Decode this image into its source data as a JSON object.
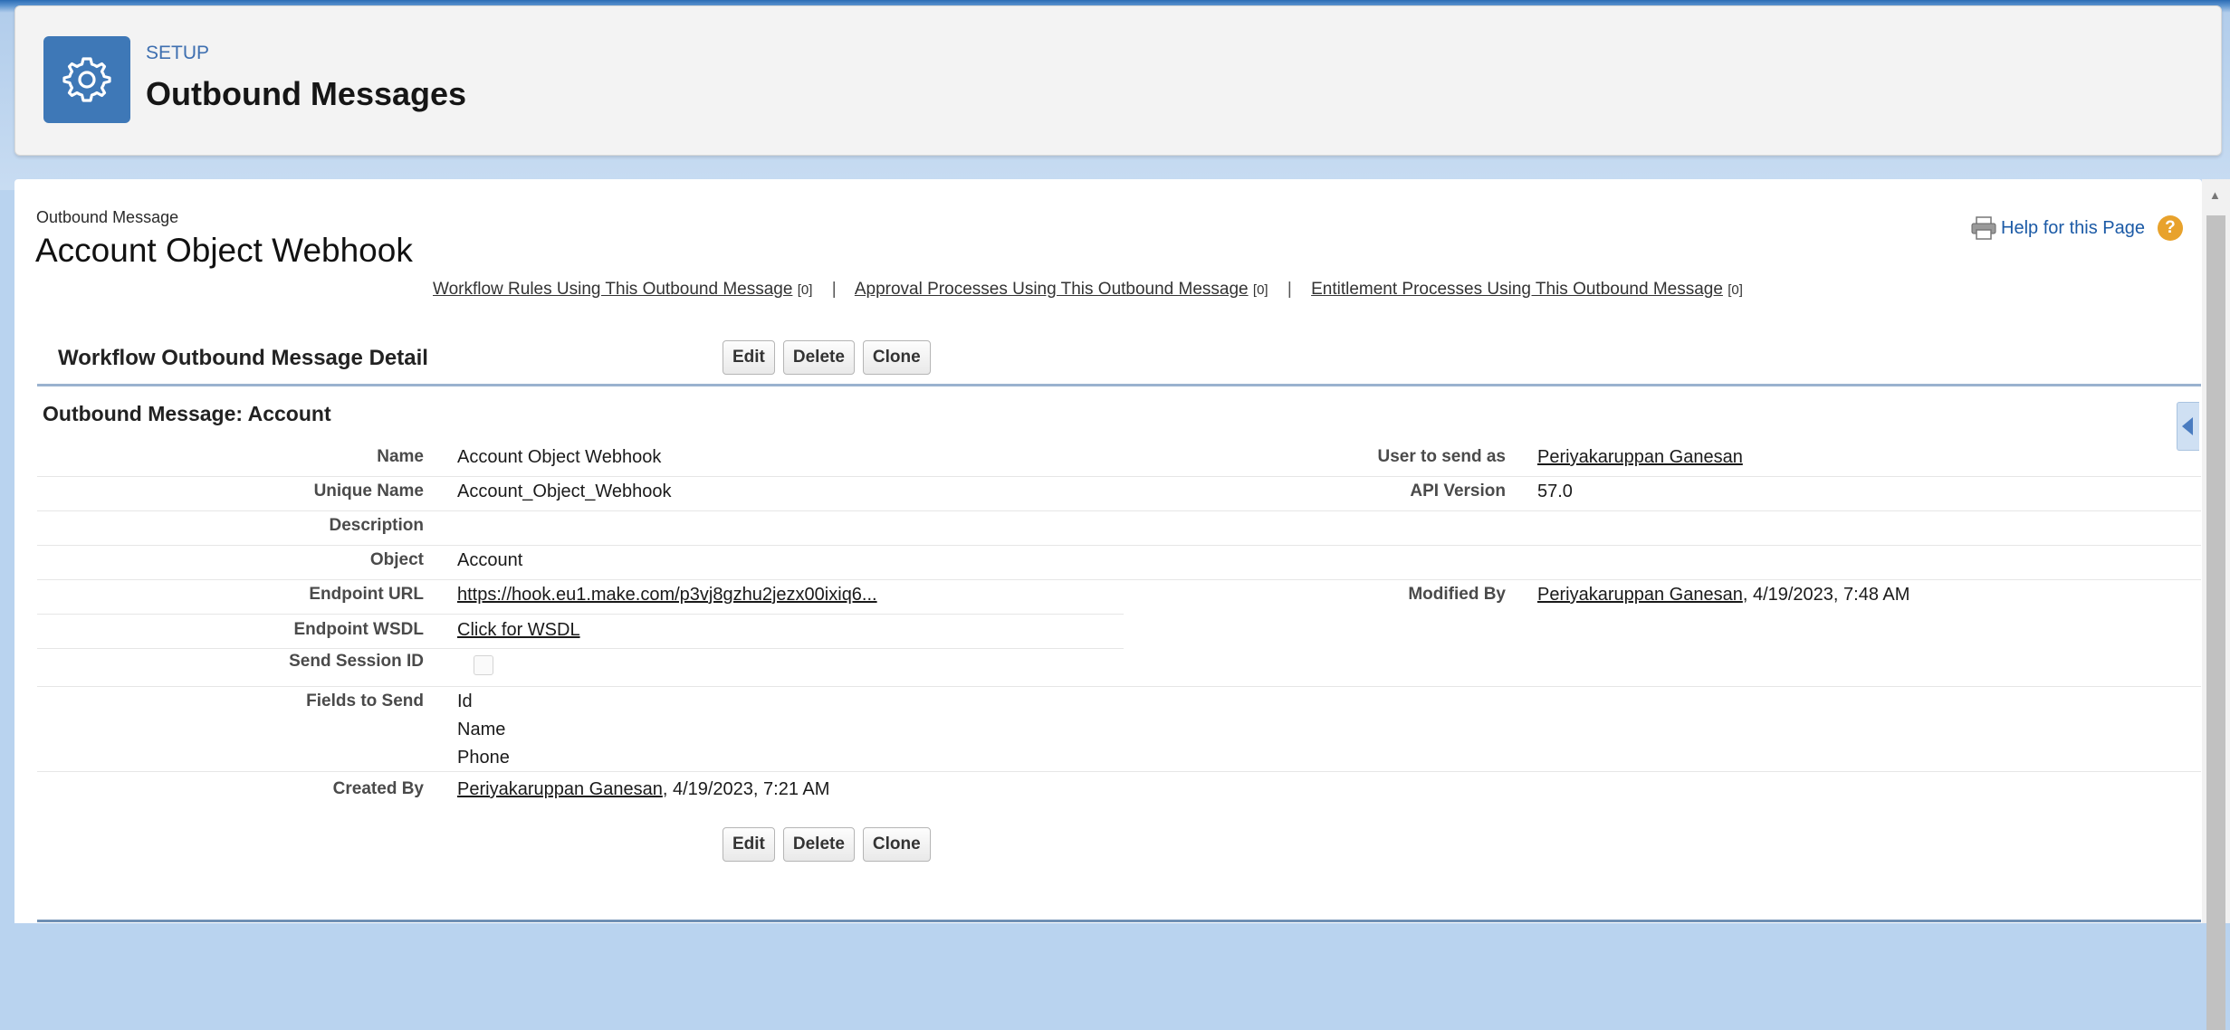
{
  "header": {
    "eyebrow": "SETUP",
    "title": "Outbound Messages",
    "icon": "gear-icon",
    "accent_color": "#3e78b7"
  },
  "record": {
    "type_label": "Outbound Message",
    "title": "Account Object Webhook",
    "help_label": "Help for this Page",
    "related_links": [
      {
        "label": "Workflow Rules Using This Outbound Message",
        "count": "[0]"
      },
      {
        "label": "Approval Processes Using This Outbound Message",
        "count": "[0]"
      },
      {
        "label": "Entitlement Processes Using This Outbound Message",
        "count": "[0]"
      }
    ],
    "separator": "|"
  },
  "detail": {
    "title": "Workflow Outbound Message Detail",
    "buttons": {
      "edit": "Edit",
      "delete": "Delete",
      "clone": "Clone"
    },
    "section_title": "Outbound Message: Account",
    "fields": {
      "name": {
        "label": "Name",
        "value": "Account Object Webhook"
      },
      "unique_name": {
        "label": "Unique Name",
        "value": "Account_Object_Webhook"
      },
      "description": {
        "label": "Description",
        "value": ""
      },
      "object": {
        "label": "Object",
        "value": "Account"
      },
      "endpoint_url": {
        "label": "Endpoint URL",
        "value": "https://hook.eu1.make.com/p3vj8gzhu2jezx00ixiq6..."
      },
      "endpoint_wsdl": {
        "label": "Endpoint WSDL",
        "value": "Click for WSDL"
      },
      "send_session_id": {
        "label": "Send Session ID",
        "checked": false
      },
      "fields_to_send": {
        "label": "Fields to Send",
        "values": [
          "Id",
          "Name",
          "Phone"
        ]
      },
      "created_by": {
        "label": "Created By",
        "user": "Periyakaruppan Ganesan",
        "date": ", 4/19/2023, 7:21 AM"
      },
      "user_to_send_as": {
        "label": "User to send as",
        "value": "Periyakaruppan Ganesan"
      },
      "api_version": {
        "label": "API Version",
        "value": "57.0"
      },
      "modified_by": {
        "label": "Modified By",
        "user": "Periyakaruppan Ganesan",
        "date": ", 4/19/2023, 7:48 AM"
      }
    }
  }
}
